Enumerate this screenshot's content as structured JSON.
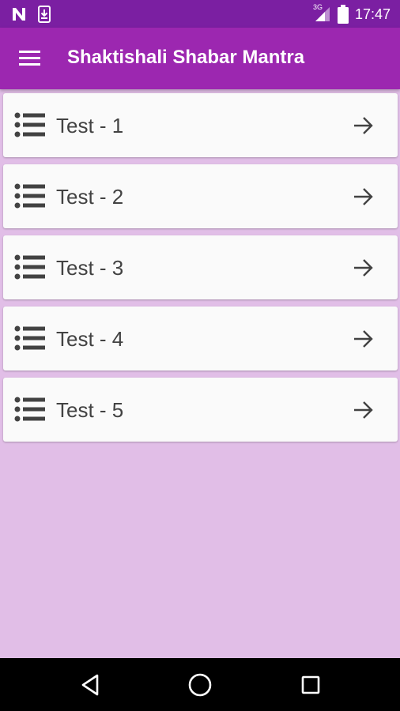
{
  "status_bar": {
    "time": "17:47",
    "network": "3G",
    "icons": [
      "n-notification-icon",
      "download-notification-icon",
      "signal-icon",
      "battery-icon"
    ]
  },
  "app_bar": {
    "title": "Shaktishali Shabar Mantra",
    "menu_icon": "hamburger-menu-icon"
  },
  "list": {
    "items": [
      {
        "label": "Test - 1"
      },
      {
        "label": "Test - 2"
      },
      {
        "label": "Test - 3"
      },
      {
        "label": "Test - 4"
      },
      {
        "label": "Test - 5"
      }
    ]
  },
  "nav_bar": {
    "buttons": [
      "back-icon",
      "home-icon",
      "recents-icon"
    ]
  },
  "colors": {
    "status_bar": "#7b1fa2",
    "app_bar": "#9c27b0",
    "background": "#e1bee7",
    "card": "#fafafa",
    "text": "#424242"
  }
}
